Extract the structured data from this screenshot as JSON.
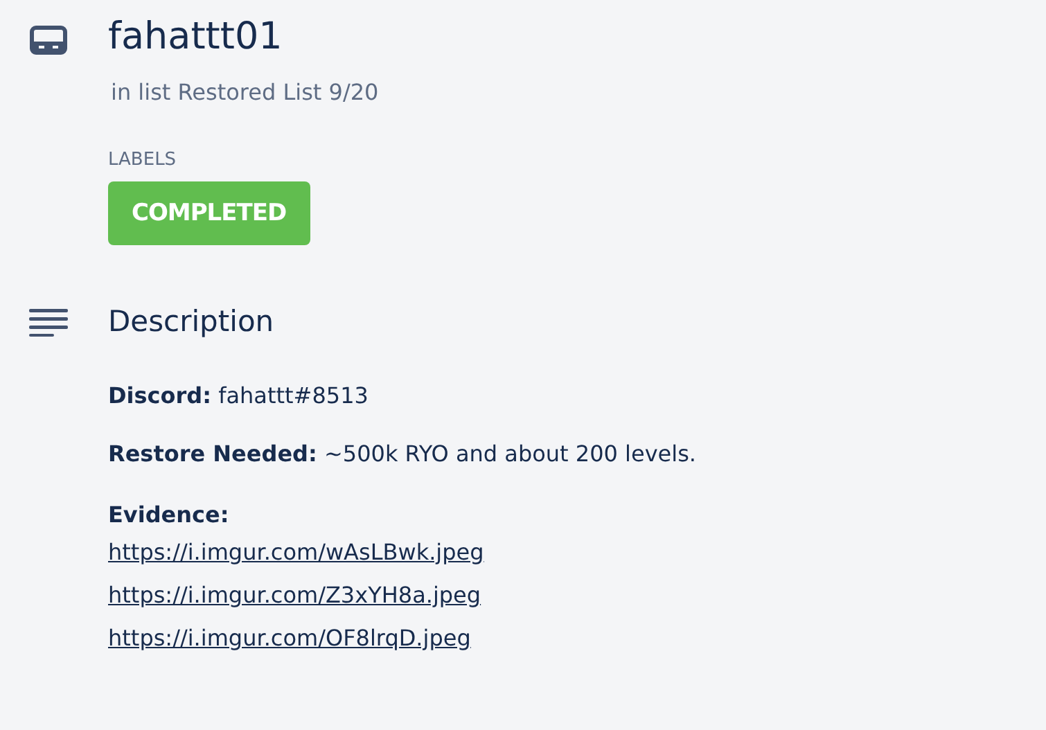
{
  "card": {
    "title": "fahattt01",
    "list_info": "in list Restored List 9/20"
  },
  "labels": {
    "heading": "LABELS",
    "items": [
      {
        "text": "COMPLETED",
        "color": "#61bd4f"
      }
    ]
  },
  "description": {
    "heading": "Description",
    "paragraphs": [
      "**Discord:** fahattt#8513",
      "**Restore Needed:** ~500k RYO and about 200 levels."
    ],
    "evidence_heading": "Evidence:",
    "links": [
      "https://i.imgur.com/wAsLBwk.jpeg",
      "https://i.imgur.com/Z3xYH8a.jpeg",
      "https://i.imgur.com/OF8lrqD.jpeg"
    ]
  }
}
